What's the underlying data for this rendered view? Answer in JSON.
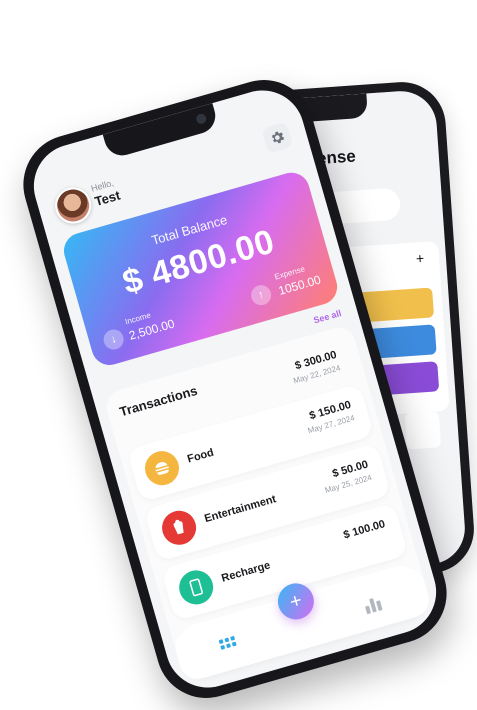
{
  "back_screen": {
    "title": "d Expense",
    "plus_icon": "+",
    "category_colors": [
      "#f1c04c",
      "#3d8bde",
      "#8a4cd6"
    ]
  },
  "front_screen": {
    "greeting": "Hello,",
    "username": "Test",
    "balance_card": {
      "label": "Total Balance",
      "amount": "$ 4800.00",
      "income_label": "Income",
      "income_value": "2,500.00",
      "expense_label": "Expense",
      "expense_value": "1050.00"
    },
    "see_all_label": "See all",
    "transactions_title": "Transactions",
    "transactions": [
      {
        "name": "",
        "amount": "$ 300.00",
        "date": "May 22, 2024",
        "color": ""
      },
      {
        "name": "Food",
        "amount": "$ 150.00",
        "date": "May 27, 2024",
        "color": "#f4b63e"
      },
      {
        "name": "Entertainment",
        "amount": "$ 50.00",
        "date": "May 25, 2024",
        "color": "#e53935"
      },
      {
        "name": "Recharge",
        "amount": "$ 100.00",
        "date": "",
        "color": "#1fbf95"
      },
      {
        "name": "",
        "amount": "",
        "date": "",
        "color": "#3d8bde"
      }
    ],
    "nav": {
      "add_label": "+"
    }
  }
}
